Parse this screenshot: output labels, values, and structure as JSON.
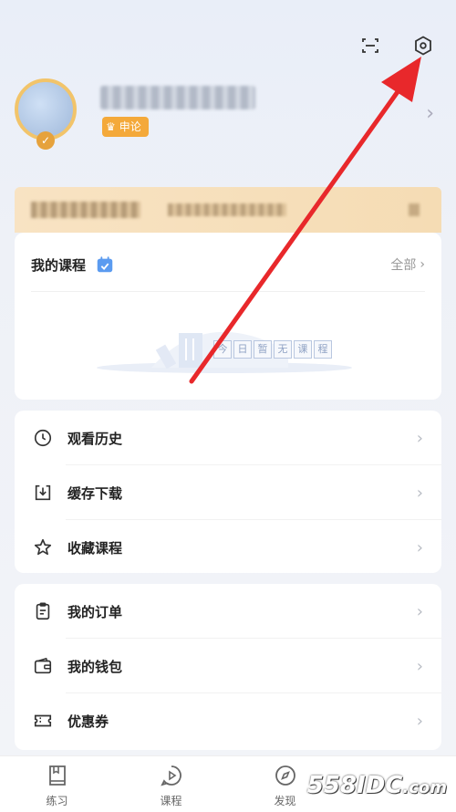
{
  "header": {
    "scan_icon": "scan-icon",
    "settings_icon": "settings-gear-icon"
  },
  "profile": {
    "vip_label": "申论"
  },
  "courses": {
    "title": "我的课程",
    "all_label": "全部",
    "empty_chars": [
      "今",
      "日",
      "暂",
      "无",
      "课",
      "程"
    ]
  },
  "menu_group1": [
    {
      "label": "观看历史",
      "icon": "clock-icon"
    },
    {
      "label": "缓存下载",
      "icon": "download-icon"
    },
    {
      "label": "收藏课程",
      "icon": "star-icon"
    }
  ],
  "menu_group2": [
    {
      "label": "我的订单",
      "icon": "order-clipboard-icon"
    },
    {
      "label": "我的钱包",
      "icon": "wallet-icon"
    },
    {
      "label": "优惠券",
      "icon": "coupon-icon"
    }
  ],
  "tabbar": [
    {
      "label": "练习",
      "icon": "book-icon"
    },
    {
      "label": "课程",
      "icon": "play-icon"
    },
    {
      "label": "发现",
      "icon": "discover-icon"
    }
  ],
  "watermark": {
    "brand": "558IDC",
    "suffix": ".com"
  },
  "colors": {
    "accent_blue": "#4a90e2",
    "vip_orange": "#f4a93a",
    "arrow_red": "#e8282b"
  }
}
